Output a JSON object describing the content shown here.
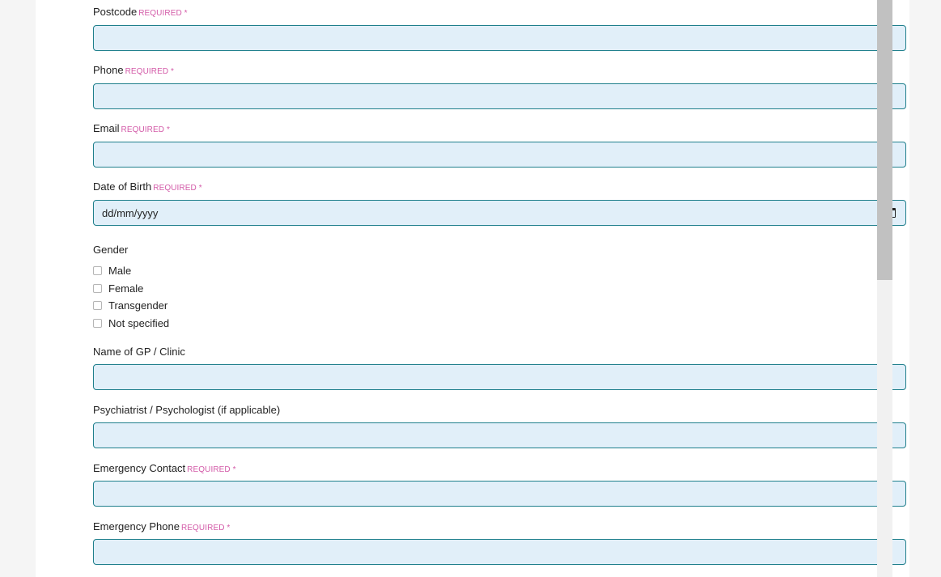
{
  "form": {
    "required_text": "REQUIRED *",
    "postcode": {
      "label": "Postcode",
      "value": ""
    },
    "phone": {
      "label": "Phone",
      "value": ""
    },
    "email": {
      "label": "Email",
      "value": ""
    },
    "dob": {
      "label": "Date of Birth",
      "placeholder": "dd/mm/yyyy"
    },
    "gender": {
      "label": "Gender",
      "options": [
        "Male",
        "Female",
        "Transgender",
        "Not specified"
      ]
    },
    "gp": {
      "label": "Name of GP / Clinic",
      "value": ""
    },
    "psychiatrist": {
      "label": "Psychiatrist / Psychologist (if applicable)",
      "value": ""
    },
    "emergency_contact": {
      "label": "Emergency Contact",
      "value": ""
    },
    "emergency_phone": {
      "label": "Emergency Phone",
      "value": ""
    }
  },
  "icons": {
    "date_picker": "calendar-icon"
  },
  "colors": {
    "required": "#d35aa8",
    "input_bg": "#e1eff9",
    "input_border": "#1f7f8c"
  }
}
